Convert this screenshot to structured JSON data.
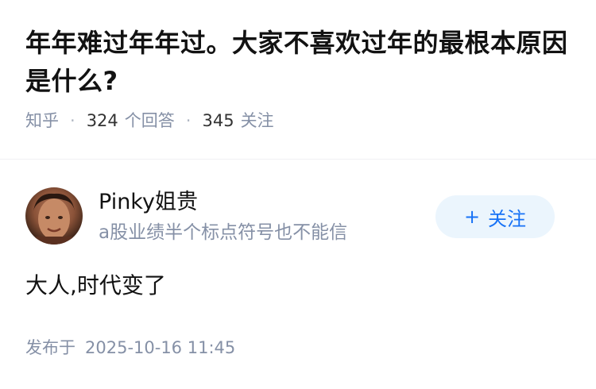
{
  "question": {
    "title": "年年难过年年过。大家不喜欢过年的最根本原因是什么?",
    "source": "知乎",
    "answer_count": "324",
    "answer_label": "个回答",
    "follower_count": "345",
    "follower_label": "关注"
  },
  "author": {
    "name": "Pinky姐贵",
    "bio": "a股业绩半个标点符号也不能信",
    "follow_button": "关注",
    "follow_icon": "plus-icon"
  },
  "answer": {
    "text": "大人,时代变了",
    "publish_label": "发布于",
    "publish_time": "2025-10-16 11:45"
  },
  "colors": {
    "accent": "#1772f6",
    "button_bg": "#ebf5fd",
    "meta_text": "#8590a6"
  }
}
